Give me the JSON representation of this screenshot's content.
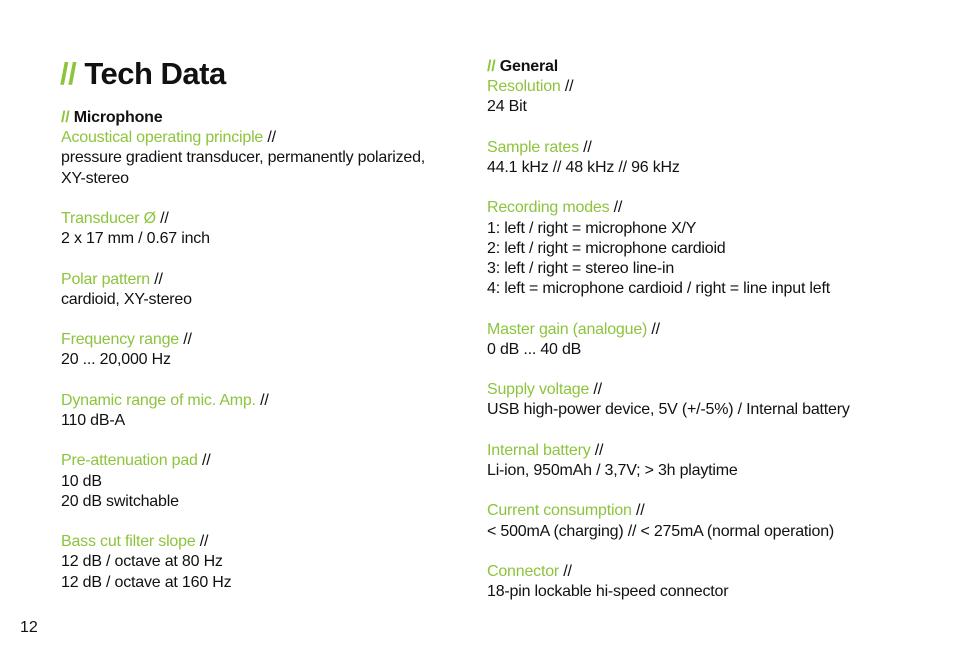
{
  "page": {
    "title_prefix": "//",
    "title": "Tech Data",
    "page_number": "12",
    "accent_color": "#8cc43c",
    "separator": "//"
  },
  "microphone": {
    "heading_prefix": "//",
    "heading": "Microphone",
    "specs": [
      {
        "label": "Acoustical operating principle",
        "values": [
          "pressure gradient transducer, permanently polarized,",
          "XY-stereo"
        ]
      },
      {
        "label": "Transducer Ø",
        "values": [
          "2 x 17 mm / 0.67 inch"
        ]
      },
      {
        "label": "Polar pattern",
        "values": [
          "cardioid, XY-stereo"
        ]
      },
      {
        "label": "Frequency range",
        "values": [
          "20 ... 20,000 Hz"
        ]
      },
      {
        "label": "Dynamic range of mic. Amp.",
        "values": [
          "110 dB-A"
        ]
      },
      {
        "label": "Pre-attenuation pad",
        "values": [
          "10 dB",
          "20 dB switchable"
        ]
      },
      {
        "label": "Bass cut filter slope",
        "values": [
          "12 dB / octave at 80 Hz",
          "12 dB / octave at 160 Hz"
        ]
      }
    ]
  },
  "general": {
    "heading_prefix": "//",
    "heading": "General",
    "specs": [
      {
        "label": "Resolution",
        "values": [
          "24 Bit"
        ]
      },
      {
        "label": "Sample rates",
        "values": [
          "44.1 kHz  // 48 kHz // 96 kHz"
        ]
      },
      {
        "label": "Recording modes",
        "values": [
          "1: left / right = microphone X/Y",
          "2: left / right = microphone cardioid",
          "3: left / right = stereo line-in",
          "4: left = microphone cardioid / right = line input left"
        ]
      },
      {
        "label": "Master gain (analogue)",
        "values": [
          "0 dB ... 40 dB"
        ]
      },
      {
        "label": "Supply voltage",
        "values": [
          "USB high-power device, 5V (+/-5%) / Internal battery"
        ]
      },
      {
        "label": "Internal battery",
        "values": [
          "Li-ion, 950mAh / 3,7V; > 3h playtime"
        ]
      },
      {
        "label": "Current consumption",
        "values": [
          "< 500mA (charging) // < 275mA (normal operation)"
        ]
      },
      {
        "label": "Connector",
        "values": [
          "18-pin lockable hi-speed connector"
        ]
      }
    ]
  }
}
